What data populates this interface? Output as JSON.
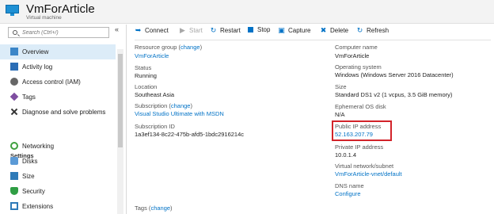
{
  "header": {
    "title": "VmForArticle",
    "subtitle": "Virtual machine"
  },
  "sidebar": {
    "search_placeholder": "Search (Ctrl+/)",
    "collapse_glyph": "«",
    "items": [
      {
        "label": "Overview",
        "icon": "overview-icon"
      },
      {
        "label": "Activity log",
        "icon": "activity-log-icon"
      },
      {
        "label": "Access control (IAM)",
        "icon": "iam-icon"
      },
      {
        "label": "Tags",
        "icon": "tag-icon"
      },
      {
        "label": "Diagnose and solve problems",
        "icon": "wrench-icon"
      }
    ],
    "settings_header": "Settings",
    "settings_items": [
      {
        "label": "Networking",
        "icon": "network-icon"
      },
      {
        "label": "Disks",
        "icon": "disk-icon"
      },
      {
        "label": "Size",
        "icon": "size-icon"
      },
      {
        "label": "Security",
        "icon": "shield-icon"
      },
      {
        "label": "Extensions",
        "icon": "extensions-icon"
      }
    ]
  },
  "toolbar": {
    "connect": "Connect",
    "start": "Start",
    "restart": "Restart",
    "stop": "Stop",
    "capture": "Capture",
    "delete": "Delete",
    "refresh": "Refresh"
  },
  "essentials": {
    "left": {
      "resource_group_label": "Resource group",
      "change": "change",
      "resource_group_value": "VmForArticle",
      "status_label": "Status",
      "status_value": "Running",
      "location_label": "Location",
      "location_value": "Southeast Asia",
      "subscription_label": "Subscription",
      "subscription_value": "Visual Studio Ultimate with MSDN",
      "subscription_id_label": "Subscription ID",
      "subscription_id_value": "1a3ef134-8c22-475b-afd5-1bdc2916214c",
      "tags_label": "Tags"
    },
    "right": {
      "computer_name_label": "Computer name",
      "computer_name_value": "VmForArticle",
      "os_label": "Operating system",
      "os_value": "Windows (Windows Server 2016 Datacenter)",
      "size_label": "Size",
      "size_value": "Standard DS1 v2 (1 vcpus, 3.5 GiB memory)",
      "ephemeral_label": "Ephemeral OS disk",
      "ephemeral_value": "N/A",
      "public_ip_label": "Public IP address",
      "public_ip_value": "52.163.207.79",
      "private_ip_label": "Private IP address",
      "private_ip_value": "10.0.1.4",
      "vnet_label": "Virtual network/subnet",
      "vnet_value": "VmForArticle-vnet/default",
      "dns_label": "DNS name",
      "dns_value": "Configure"
    }
  },
  "colors": {
    "accent": "#0072c6",
    "highlight_box": "#d2232a",
    "active_nav": "#dcecf8"
  }
}
